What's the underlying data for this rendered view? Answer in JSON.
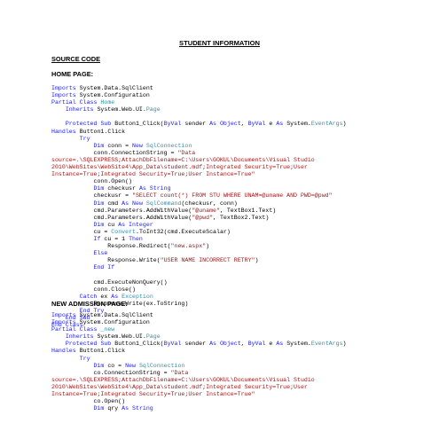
{
  "document": {
    "title": "STUDENT INFORMATION",
    "source_heading": "SOURCE CODE",
    "home_heading": "HOME PAGE:",
    "new_heading": "NEW ADMISSION PAGE:"
  },
  "colors": {
    "keyword": "#1a1aff",
    "type": "#2b91af",
    "string": "#a31515",
    "text": "#000000"
  },
  "home_code": [
    [
      [
        "k",
        "Imports"
      ],
      [
        "n",
        " System.Data.SqlClient"
      ]
    ],
    [
      [
        "k",
        "Imports"
      ],
      [
        "n",
        " System.Configuration"
      ]
    ],
    [
      [
        "k",
        "Partial Class"
      ],
      [
        "n",
        " "
      ],
      [
        "t",
        "Home"
      ]
    ],
    [
      [
        "n",
        "    "
      ],
      [
        "k",
        "Inherits"
      ],
      [
        "n",
        " System.Web.UI."
      ],
      [
        "t",
        "Page"
      ]
    ],
    [],
    [
      [
        "n",
        "    "
      ],
      [
        "k",
        "Protected Sub"
      ],
      [
        "n",
        " Button1_Click("
      ],
      [
        "k",
        "ByVal"
      ],
      [
        "n",
        " sender "
      ],
      [
        "k",
        "As Object"
      ],
      [
        "n",
        ", "
      ],
      [
        "k",
        "ByVal"
      ],
      [
        "n",
        " e "
      ],
      [
        "k",
        "As"
      ],
      [
        "n",
        " System."
      ],
      [
        "t",
        "EventArgs"
      ],
      [
        "n",
        ")"
      ]
    ],
    [
      [
        "k",
        "Handles"
      ],
      [
        "n",
        " Button1.Click"
      ]
    ],
    [
      [
        "n",
        "        "
      ],
      [
        "k",
        "Try"
      ]
    ],
    [
      [
        "n",
        "            "
      ],
      [
        "k",
        "Dim"
      ],
      [
        "n",
        " conn = "
      ],
      [
        "k",
        "New"
      ],
      [
        "n",
        " "
      ],
      [
        "t",
        "SqlConnection"
      ]
    ],
    [
      [
        "n",
        "            conn.ConnectionString = "
      ],
      [
        "s",
        "\"Data"
      ]
    ],
    [
      [
        "s",
        "source=.\\SQLEXPRESS;AttachDbFilename=C:\\Users\\GOKUL\\Documents\\Visual Studio"
      ]
    ],
    [
      [
        "s",
        "2010\\WebSites\\WebSite4\\App_Data\\student.mdf;Integrated Security=True;User"
      ]
    ],
    [
      [
        "s",
        "Instance=True;Integrated Security=True;User Instance=True\""
      ]
    ],
    [
      [
        "n",
        "            conn.Open()"
      ]
    ],
    [
      [
        "n",
        "            "
      ],
      [
        "k",
        "Dim"
      ],
      [
        "n",
        " checkusr "
      ],
      [
        "k",
        "As String"
      ]
    ],
    [
      [
        "n",
        "            checkusr = "
      ],
      [
        "s",
        "\"SELECT count(*) FROM STU WHERE UNAM=@uname AND PWD=@pwd\""
      ]
    ],
    [
      [
        "n",
        "            "
      ],
      [
        "k",
        "Dim"
      ],
      [
        "n",
        " cmd "
      ],
      [
        "k",
        "As New"
      ],
      [
        "n",
        " "
      ],
      [
        "t",
        "SqlCommand"
      ],
      [
        "n",
        "(checkusr, conn)"
      ]
    ],
    [
      [
        "n",
        "            cmd.Parameters.AddWithValue("
      ],
      [
        "s",
        "\"@uname\""
      ],
      [
        "n",
        ", TextBox1.Text)"
      ]
    ],
    [
      [
        "n",
        "            cmd.Parameters.AddWithValue("
      ],
      [
        "s",
        "\"@pwd\""
      ],
      [
        "n",
        ", TextBox2.Text)"
      ]
    ],
    [
      [
        "n",
        "            "
      ],
      [
        "k",
        "Dim"
      ],
      [
        "n",
        " cu "
      ],
      [
        "k",
        "As Integer"
      ]
    ],
    [
      [
        "n",
        "            cu = "
      ],
      [
        "t",
        "Convert"
      ],
      [
        "n",
        ".ToInt32(cmd.ExecuteScalar)"
      ]
    ],
    [
      [
        "n",
        "            "
      ],
      [
        "k",
        "If"
      ],
      [
        "n",
        " cu = 1 "
      ],
      [
        "k",
        "Then"
      ]
    ],
    [
      [
        "n",
        "                Response.Redirect("
      ],
      [
        "s",
        "\"new.aspx\""
      ],
      [
        "n",
        ")"
      ]
    ],
    [
      [
        "n",
        "            "
      ],
      [
        "k",
        "Else"
      ]
    ],
    [
      [
        "n",
        "                Response.Write("
      ],
      [
        "s",
        "\"USER NAME INCORRECT RETRY\""
      ],
      [
        "n",
        ")"
      ]
    ],
    [
      [
        "n",
        "            "
      ],
      [
        "k",
        "End If"
      ]
    ],
    [],
    [
      [
        "n",
        "            cmd.ExecuteNonQuery()"
      ]
    ],
    [
      [
        "n",
        "            conn.Close()"
      ]
    ],
    [
      [
        "n",
        "        "
      ],
      [
        "k",
        "Catch"
      ],
      [
        "n",
        " ex "
      ],
      [
        "k",
        "As"
      ],
      [
        "n",
        " "
      ],
      [
        "t",
        "Exception"
      ]
    ],
    [
      [
        "n",
        "            Response.Write(ex.ToString)"
      ]
    ],
    [
      [
        "n",
        "        "
      ],
      [
        "k",
        "End Try"
      ]
    ],
    [
      [
        "n",
        "    "
      ],
      [
        "k",
        "End Sub"
      ]
    ],
    [
      [
        "k",
        "End Class"
      ]
    ]
  ],
  "new_code": [
    [
      [
        "k",
        "Imports"
      ],
      [
        "n",
        " System.Data.SqlClient"
      ]
    ],
    [
      [
        "k",
        "Imports"
      ],
      [
        "n",
        " System.Configuration"
      ]
    ],
    [
      [
        "k",
        "Partial Class"
      ],
      [
        "n",
        " "
      ],
      [
        "t",
        "_new"
      ]
    ],
    [
      [
        "n",
        "    "
      ],
      [
        "k",
        "Inherits"
      ],
      [
        "n",
        " System.Web.UI."
      ],
      [
        "t",
        "Page"
      ]
    ],
    [
      [
        "n",
        "    "
      ],
      [
        "k",
        "Protected Sub"
      ],
      [
        "n",
        " Button1_Click("
      ],
      [
        "k",
        "ByVal"
      ],
      [
        "n",
        " sender "
      ],
      [
        "k",
        "As Object"
      ],
      [
        "n",
        ", "
      ],
      [
        "k",
        "ByVal"
      ],
      [
        "n",
        " e "
      ],
      [
        "k",
        "As"
      ],
      [
        "n",
        " System."
      ],
      [
        "t",
        "EventArgs"
      ],
      [
        "n",
        ")"
      ]
    ],
    [
      [
        "k",
        "Handles"
      ],
      [
        "n",
        " Button1.Click"
      ]
    ],
    [
      [
        "n",
        "        "
      ],
      [
        "k",
        "Try"
      ]
    ],
    [
      [
        "n",
        "            "
      ],
      [
        "k",
        "Dim"
      ],
      [
        "n",
        " co = "
      ],
      [
        "k",
        "New"
      ],
      [
        "n",
        " "
      ],
      [
        "t",
        "SqlConnection"
      ]
    ],
    [
      [
        "n",
        "            co.ConnectionString = "
      ],
      [
        "s",
        "\"Data"
      ]
    ],
    [
      [
        "s",
        "source=.\\SQLEXPRESS;AttachDbFilename=C:\\Users\\GOKUL\\Documents\\Visual Studio"
      ]
    ],
    [
      [
        "s",
        "2010\\WebSites\\WebSite4\\App_Data\\student.mdf;Integrated Security=True;User"
      ]
    ],
    [
      [
        "s",
        "Instance=True;Integrated Security=True;User Instance=True\""
      ]
    ],
    [
      [
        "n",
        "            co.Open()"
      ]
    ],
    [
      [
        "n",
        "            "
      ],
      [
        "k",
        "Dim"
      ],
      [
        "n",
        " qry "
      ],
      [
        "k",
        "As String"
      ]
    ]
  ]
}
